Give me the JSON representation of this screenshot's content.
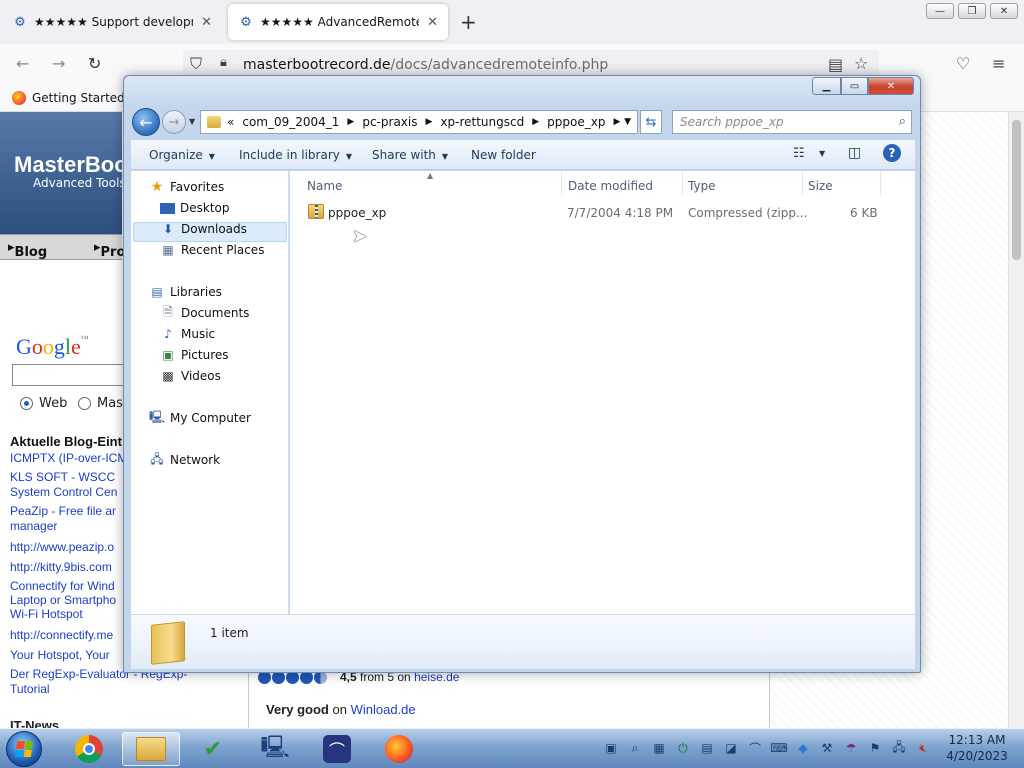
{
  "browser": {
    "tabs": [
      {
        "title": "★★★★★ Support development",
        "active": false
      },
      {
        "title": "★★★★★ AdvancedRemoteInfo",
        "active": true
      }
    ],
    "url_host": "masterbootrecord.de",
    "url_path": "/docs/advancedremoteinfo.php",
    "bookmark": "Getting Started"
  },
  "webpage": {
    "logo": "MasterBoo",
    "logo_sub": "Advanced Tools",
    "nav": [
      "Blog",
      "Pro"
    ],
    "google_logo": "Google",
    "radio_web": "Web",
    "radio_other": "Mas",
    "blog_heading": "Aktuelle Blog-Eint",
    "blog_links": [
      "ICMPTX (IP-over-ICM",
      "KLS SOFT - WSCC",
      "System Control Cen",
      "PeaZip - Free file ar",
      "manager",
      "http://www.peazip.o",
      "http://kitty.9bis.com",
      "Connectify for Wind",
      "Laptop or Smartpho",
      "Wi-Fi Hotspot",
      "http://connectify.me",
      "Your Hotspot, Your",
      "Der RegExp-Evaluator - RegExp-",
      "Tutorial"
    ],
    "it_news": "IT-News",
    "rating_score": "4,5",
    "rating_mid": "from 5 on",
    "rating_site": "heise.de",
    "rating_stars": 5,
    "verdict": "Very good",
    "verdict_on": "on",
    "verdict_site": "Winload.de"
  },
  "explorer": {
    "breadcrumbs": [
      "com_09_2004_1",
      "pc-praxis",
      "xp-rettungscd",
      "pppoe_xp"
    ],
    "breadcrumb_overflow": "«",
    "search_placeholder": "Search pppoe_xp",
    "toolbar": {
      "organize": "Organize",
      "include_in_library": "Include in library",
      "share_with": "Share with",
      "new_folder": "New folder"
    },
    "nav": {
      "favorites": "Favorites",
      "desktop": "Desktop",
      "downloads": "Downloads",
      "recent_places": "Recent Places",
      "libraries": "Libraries",
      "documents": "Documents",
      "music": "Music",
      "pictures": "Pictures",
      "videos": "Videos",
      "my_computer": "My Computer",
      "network": "Network"
    },
    "columns": {
      "name": "Name",
      "date": "Date modified",
      "type": "Type",
      "size": "Size"
    },
    "files": [
      {
        "name": "pppoe_xp",
        "date": "7/7/2004 4:18 PM",
        "type": "Compressed (zipp...",
        "size": "6 KB"
      }
    ],
    "item_count": "1 item"
  },
  "taskbar": {
    "time": "12:13 AM",
    "date": "4/20/2023"
  },
  "colors": {
    "accent": "#2d6bbf",
    "link": "#1a3ec9",
    "selection": "#dcebfc"
  }
}
